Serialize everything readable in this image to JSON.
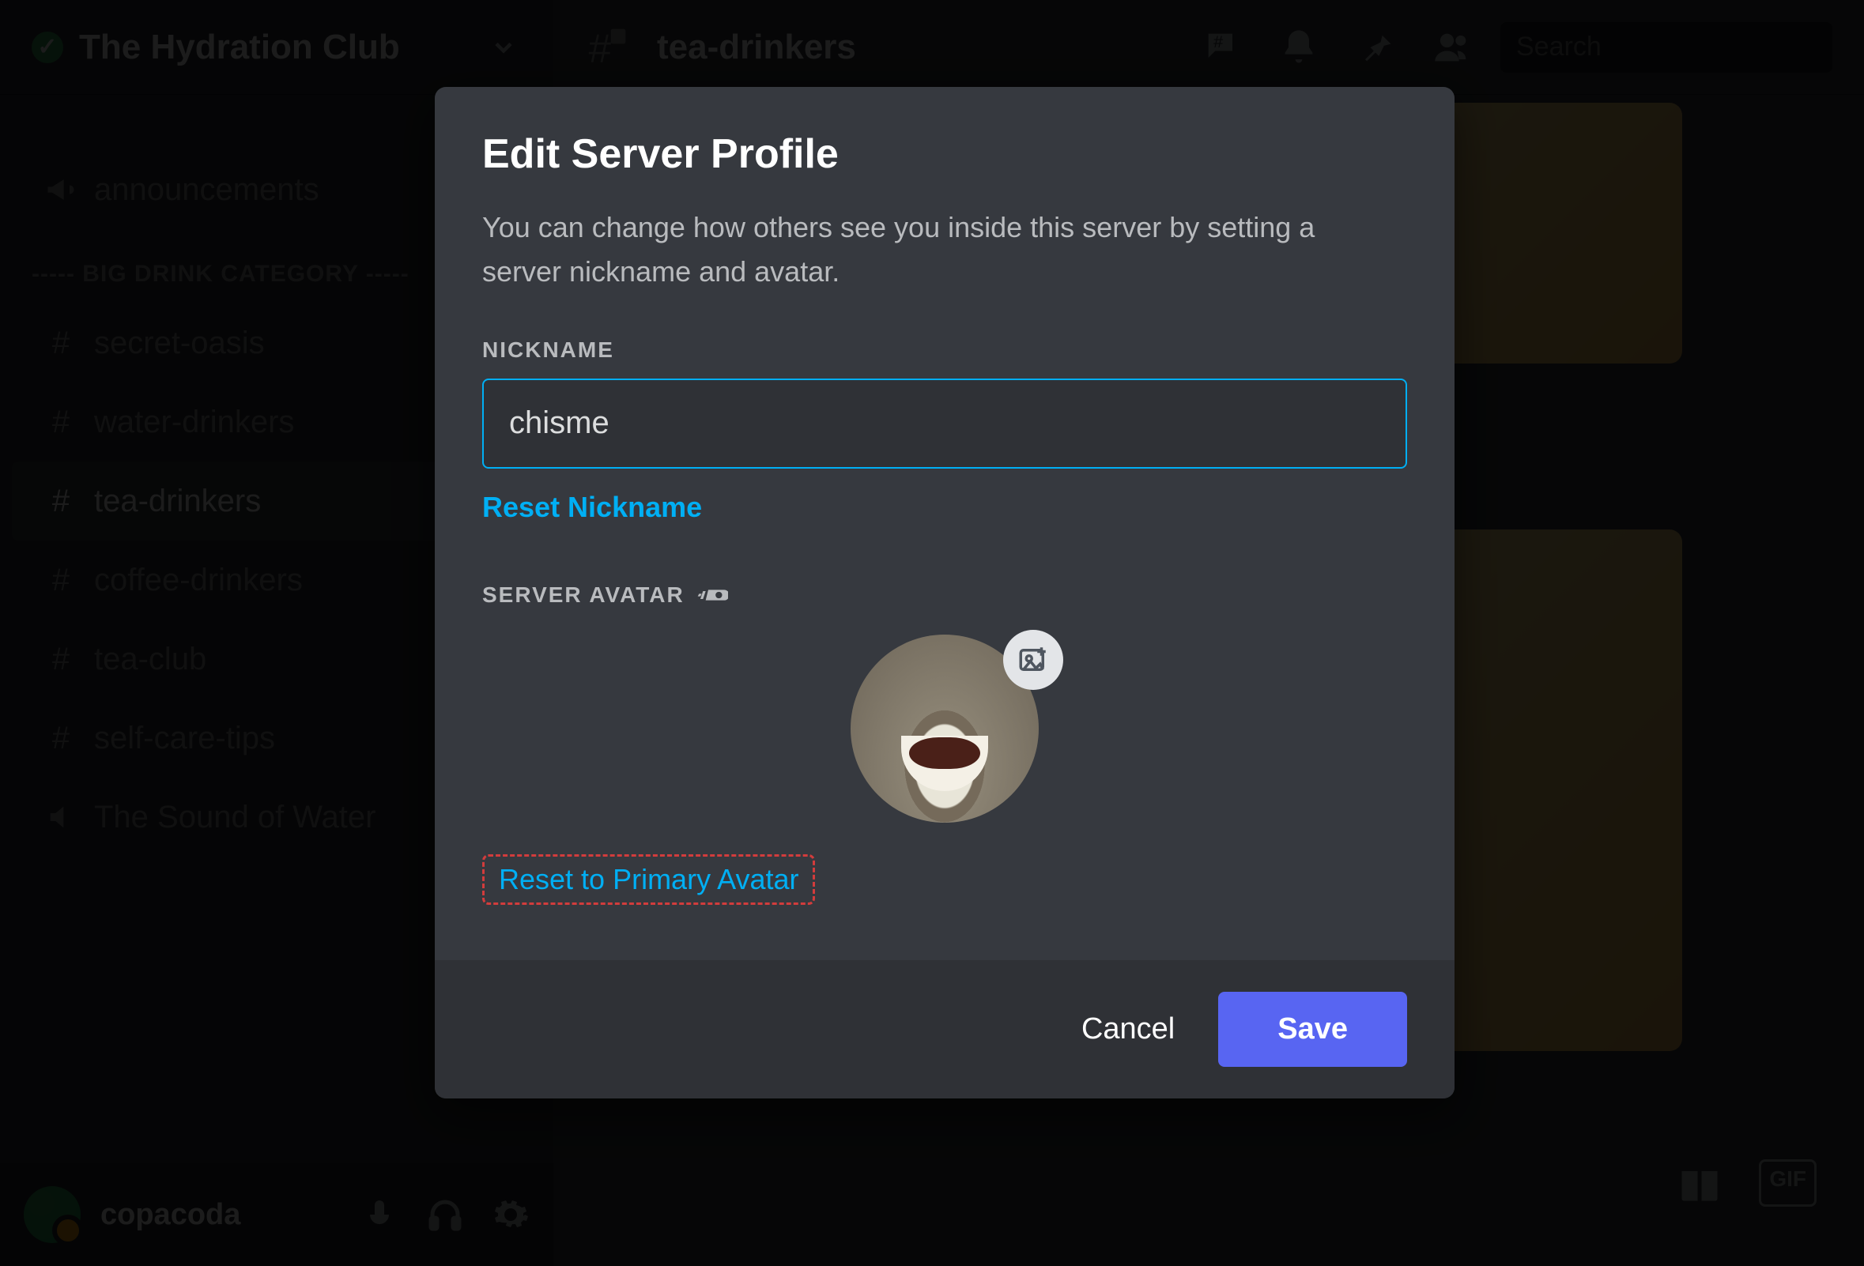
{
  "server": {
    "name": "The Hydration Club",
    "verified": true
  },
  "header": {
    "channel_icon": "hash-lock",
    "channel_name": "tea-drinkers",
    "search_placeholder": "Search"
  },
  "sidebar": {
    "top": {
      "icon": "megaphone",
      "label": "announcements"
    },
    "category_label": "----- BIG DRINK CATEGORY -----",
    "channels": [
      {
        "icon": "hash-lock",
        "label": "secret-oasis",
        "active": false
      },
      {
        "icon": "hash-lock",
        "label": "water-drinkers",
        "active": false
      },
      {
        "icon": "hash",
        "label": "tea-drinkers",
        "active": true
      },
      {
        "icon": "hash",
        "label": "coffee-drinkers",
        "active": false
      },
      {
        "icon": "hash",
        "label": "tea-club",
        "active": false
      },
      {
        "icon": "hash",
        "label": "self-care-tips",
        "active": false
      },
      {
        "icon": "speaker",
        "label": "The Sound of Water",
        "active": false
      }
    ]
  },
  "user_panel": {
    "username": "copacoda",
    "status": "idle"
  },
  "modal": {
    "title": "Edit Server Profile",
    "description": "You can change how others see you inside this server by setting a server nickname and avatar.",
    "nickname_label": "NICKNAME",
    "nickname_value": "chisme",
    "reset_nickname_label": "Reset Nickname",
    "server_avatar_label": "SERVER AVATAR",
    "nitro_badge_icon": "nitro-icon",
    "reset_avatar_label": "Reset to Primary Avatar",
    "cancel_label": "Cancel",
    "save_label": "Save"
  },
  "footer_icons": {
    "gift": "gift-icon",
    "gif": "GIF"
  }
}
